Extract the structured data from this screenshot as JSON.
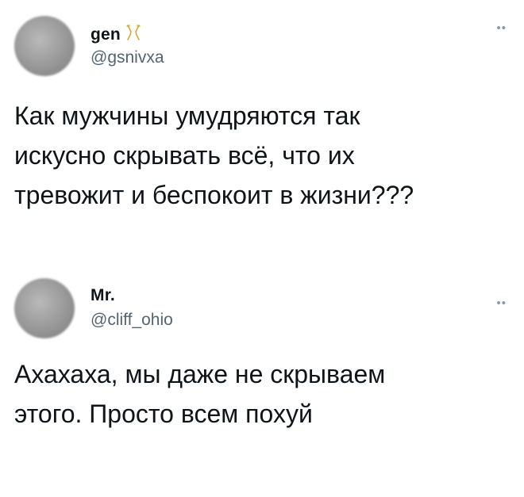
{
  "tweets": [
    {
      "display_name": "gen",
      "name_emoji": "champagne-glasses-icon",
      "handle": "@gsnivxa",
      "text": "Как мужчины умудряются так\nискусно скрывать всё, что их\nтревожит и беспокоит в жизни???",
      "more_icon": "more-options-icon"
    },
    {
      "display_name": "Mr.",
      "handle": "@cliff_ohio",
      "text": "Ахахаха, мы даже не скрываем\nэтого. Просто всем похуй",
      "more_icon": "more-options-icon"
    }
  ],
  "colors": {
    "text": "#0f1419",
    "secondary": "#536471",
    "background": "#ffffff"
  }
}
